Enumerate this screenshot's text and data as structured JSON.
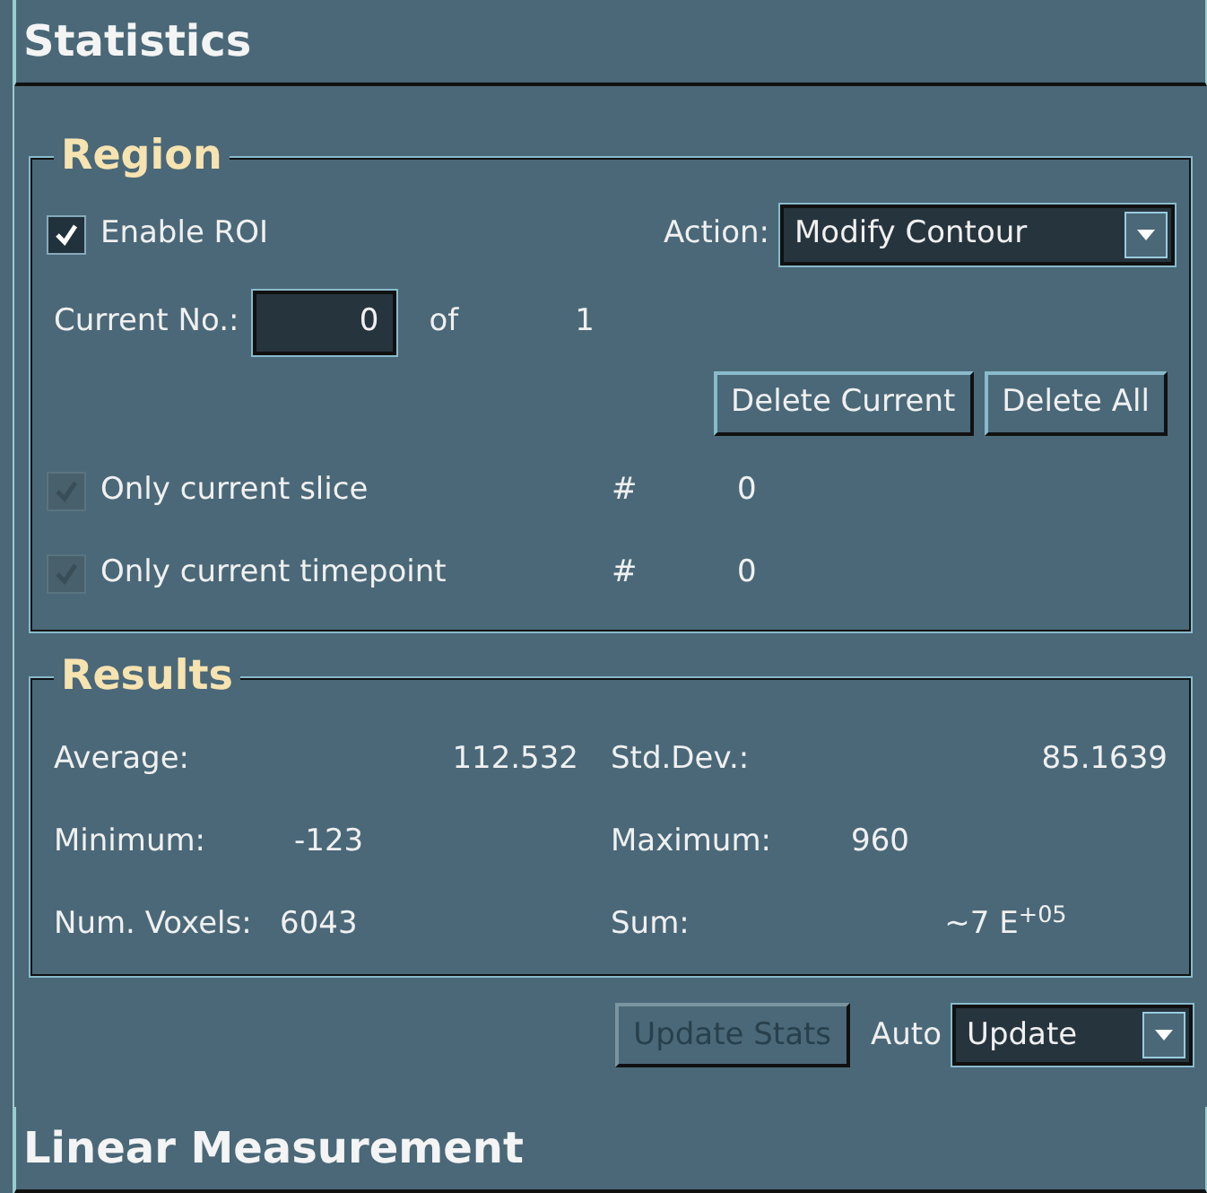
{
  "panel": {
    "title": "Statistics"
  },
  "region": {
    "legend": "Region",
    "enable_roi": {
      "label": "Enable ROI",
      "checked": true,
      "disabled": false
    },
    "action": {
      "label": "Action:",
      "value": "Modify Contour"
    },
    "current": {
      "label": "Current No.:",
      "value": "0",
      "of_label": "of",
      "total": "1"
    },
    "buttons": [
      {
        "label": "Delete Current",
        "disabled": false
      },
      {
        "label": "Delete All",
        "disabled": false
      }
    ],
    "options": [
      {
        "label": "Only current slice",
        "checked": true,
        "disabled": true,
        "hash": "#",
        "value": "0"
      },
      {
        "label": "Only current timepoint",
        "checked": true,
        "disabled": true,
        "hash": "#",
        "value": "0"
      }
    ]
  },
  "results": {
    "legend": "Results",
    "rows": [
      [
        {
          "label": "Average:",
          "value": "112.532"
        },
        {
          "label": "Std.Dev.:",
          "value": "85.1639"
        }
      ],
      [
        {
          "label": "Minimum:",
          "value": "-123"
        },
        {
          "label": "Maximum:",
          "value": "960"
        }
      ],
      [
        {
          "label": "Num. Voxels:",
          "value": "6043"
        },
        {
          "label": "Sum:",
          "value": "~7 E$^{+05}$"
        }
      ]
    ]
  },
  "update": {
    "button": {
      "label": "Update Stats",
      "disabled": true
    },
    "auto_label": "Auto",
    "mode": "Update"
  },
  "next_panel": {
    "title": "Linear Measurement"
  }
}
